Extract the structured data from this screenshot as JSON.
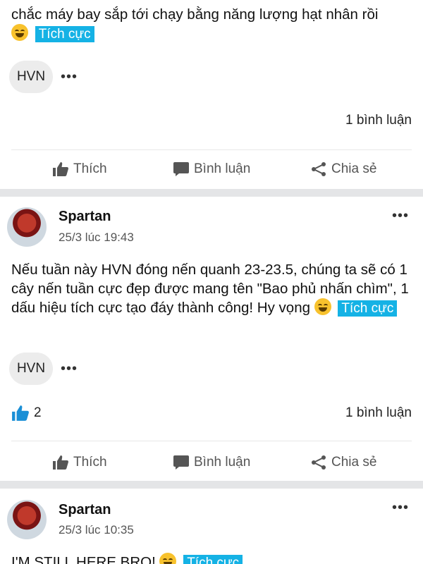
{
  "post1": {
    "text": "chắc máy bay sắp tới chạy bằng năng lượng hạt nhân rồi",
    "tag": "Tích cực",
    "chip": "HVN",
    "more": "•••",
    "comments": "1 bình luận"
  },
  "actions": {
    "like": "Thích",
    "comment": "Bình luận",
    "share": "Chia sẻ"
  },
  "post2": {
    "author": "Spartan",
    "time": "25/3 lúc 19:43",
    "more": "•••",
    "text": "Nếu tuần này HVN đóng nến quanh 23-23.5, chúng ta sẽ có 1 cây nến tuần cực đẹp được mang tên \"Bao phủ nhấn chìm\", 1 dấu hiệu tích cực tạo đáy thành công! Hy vọng",
    "tag": "Tích cực",
    "chip": "HVN",
    "chip_more": "•••",
    "likes": "2",
    "comments": "1 bình luận"
  },
  "post3": {
    "author": "Spartan",
    "time": "25/3 lúc 10:35",
    "more": "•••",
    "text": "I'M STILL HERE BRO!",
    "tag": "Tích cực"
  },
  "colors": {
    "tag_bg": "#15b2e5",
    "like_blue": "#1a8fd6",
    "separator": "#e4e5e7"
  }
}
